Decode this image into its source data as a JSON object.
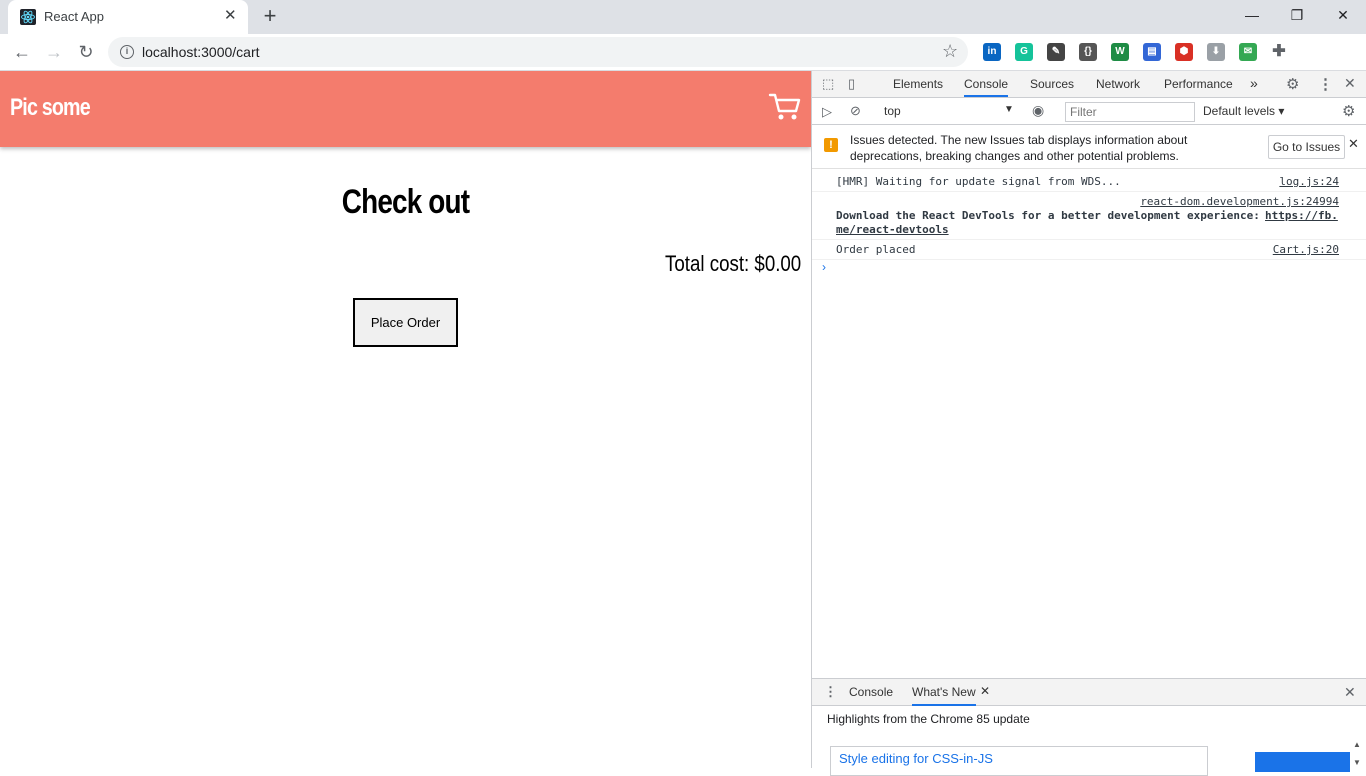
{
  "browser": {
    "tab_title": "React App",
    "tab_close": "✕",
    "new_tab": "+",
    "minimize": "—",
    "restore": "❐",
    "close": "✕",
    "url": "localhost:3000/cart",
    "info_glyph": "i",
    "star_glyph": "☆",
    "back_glyph": "←",
    "forward_glyph": "→",
    "reload_glyph": "↻",
    "extensions": [
      {
        "name": "linkedin-icon",
        "glyph": "in",
        "color": "#0a66c2"
      },
      {
        "name": "grammarly-icon",
        "glyph": "G",
        "color": "#15c39a"
      },
      {
        "name": "pen-tool-icon",
        "glyph": "✎",
        "color": "#444"
      },
      {
        "name": "json-viewer-icon",
        "glyph": "{}",
        "color": "#555"
      },
      {
        "name": "wordpress-icon",
        "glyph": "W",
        "color": "#1e8c45"
      },
      {
        "name": "store-icon",
        "glyph": "▤",
        "color": "#3367d6"
      },
      {
        "name": "shield-ext-icon",
        "glyph": "⬢",
        "color": "#d93025"
      },
      {
        "name": "download-icon",
        "glyph": "⬇",
        "color": "#9aa0a6"
      },
      {
        "name": "mail-ext-icon",
        "glyph": "✉",
        "color": "#34a853"
      },
      {
        "name": "puzzle-icon",
        "glyph": "✚",
        "color": "#5f6368"
      }
    ]
  },
  "app": {
    "brand": "Pic some",
    "heading": "Check out",
    "total": "Total cost: $0.00",
    "place_order": "Place Order",
    "header_color": "#f47c6d"
  },
  "devtools": {
    "tabs": [
      "Elements",
      "Console",
      "Sources",
      "Network",
      "Performance"
    ],
    "more": "»",
    "context": "top",
    "filter_placeholder": "Filter",
    "levels": "Default levels ▾",
    "issues_text": "Issues detected. The new Issues tab displays information about deprecations, breaking changes and other potential problems.",
    "go_to_issues": "Go to Issues",
    "issues_close": "✕",
    "logs": [
      {
        "msg": "[HMR] Waiting for update signal from WDS...",
        "src": "log.js:24"
      },
      {
        "src": "react-dom.development.js:24994",
        "msg_prefix": "Download the React DevTools for a better development experience: ",
        "link1": "https://fb.",
        "link2": "me/react-devtools"
      },
      {
        "msg": "Order placed",
        "src": "Cart.js:20"
      }
    ],
    "prompt": "›",
    "drawer_tabs": [
      "Console",
      "What's New"
    ],
    "drawer_close": "✕",
    "highlights": "Highlights from the Chrome 85 update",
    "style_link": "Style editing for CSS-in-JS",
    "accent": "#1a73e8"
  }
}
